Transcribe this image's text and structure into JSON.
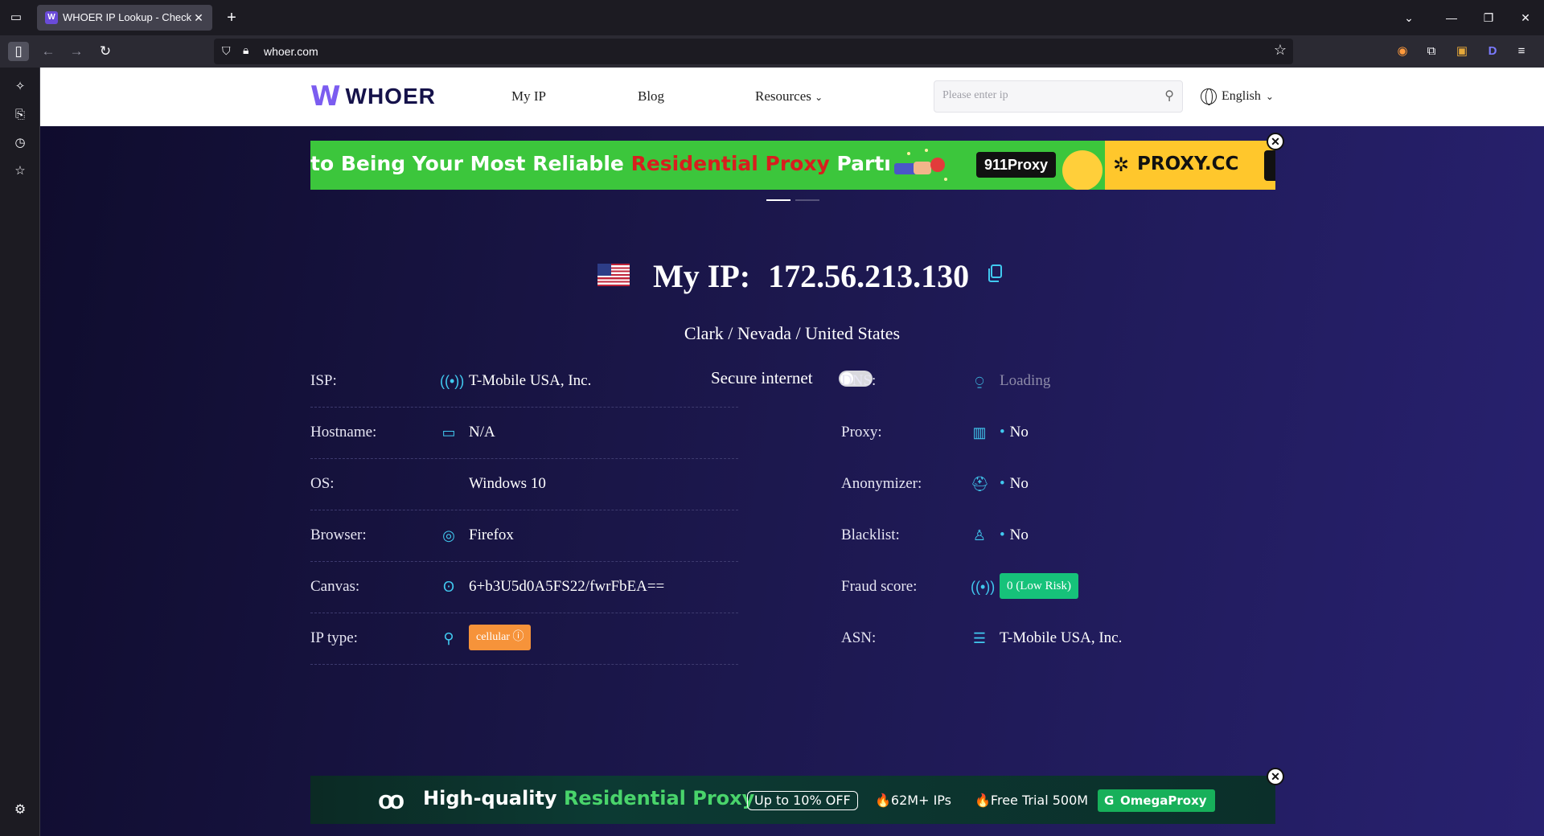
{
  "browser": {
    "tab_title": "WHOER IP Lookup - Check IP Address",
    "tab_favicon_letter": "W",
    "url": "whoer.com"
  },
  "site": {
    "logo_text": "WHOER",
    "menu": {
      "my_ip": "My IP",
      "blog": "Blog",
      "resources": "Resources"
    },
    "search_placeholder": "Please enter ip",
    "language": "English"
  },
  "banner_top": {
    "text_start": "to Being Your Most Reliable ",
    "text_highlight": "Residential Proxy",
    "text_end": " Partı",
    "brand1": "911Proxy",
    "brand2": "PROXY.CC"
  },
  "hero": {
    "label": "My IP:",
    "ip": "172.56.213.130",
    "location": "Clark / Nevada / United States",
    "secure_label": "Secure internet",
    "secure_enabled": false
  },
  "details_left": [
    {
      "label": "ISP:",
      "icon": "antenna-icon",
      "value": "T-Mobile USA, Inc."
    },
    {
      "label": "Hostname:",
      "icon": "monitor-icon",
      "value": "N/A"
    },
    {
      "label": "OS:",
      "icon": "apple-icon",
      "value": "Windows 10"
    },
    {
      "label": "Browser:",
      "icon": "chrome-icon",
      "value": "Firefox"
    },
    {
      "label": "Canvas:",
      "icon": "fingerprint-icon",
      "value": "6+b3U5d0A5FS22/fwrFbEA=="
    },
    {
      "label": "IP type:",
      "icon": "location-pin-icon",
      "value": "cellular"
    }
  ],
  "details_right": [
    {
      "label": "DNS:",
      "icon": "dns-icon",
      "value": "Loading"
    },
    {
      "label": "Proxy:",
      "icon": "proxy-icon",
      "value": "No"
    },
    {
      "label": "Anonymizer:",
      "icon": "anonymizer-icon",
      "value": "No"
    },
    {
      "label": "Blacklist:",
      "icon": "blacklist-icon",
      "value": "No"
    },
    {
      "label": "Fraud score:",
      "icon": "signal-icon",
      "value": "0 (Low Risk)"
    },
    {
      "label": "ASN:",
      "icon": "sliders-icon",
      "value": "T-Mobile USA, Inc."
    }
  ],
  "banner_bottom": {
    "title_start": "High-quality ",
    "title_highlight": "Residential Proxy",
    "discount": "Up to 10% OFF",
    "feature1": "🔥62M+ IPs",
    "feature2": "🔥Free Trial 500M",
    "brand": "OmegaProxy"
  },
  "colors": {
    "accent_cyan": "#41c9f0",
    "fraud_green": "#16c27a",
    "iptype_orange": "#f6933a",
    "logo_purple": "#7b5cf0"
  }
}
